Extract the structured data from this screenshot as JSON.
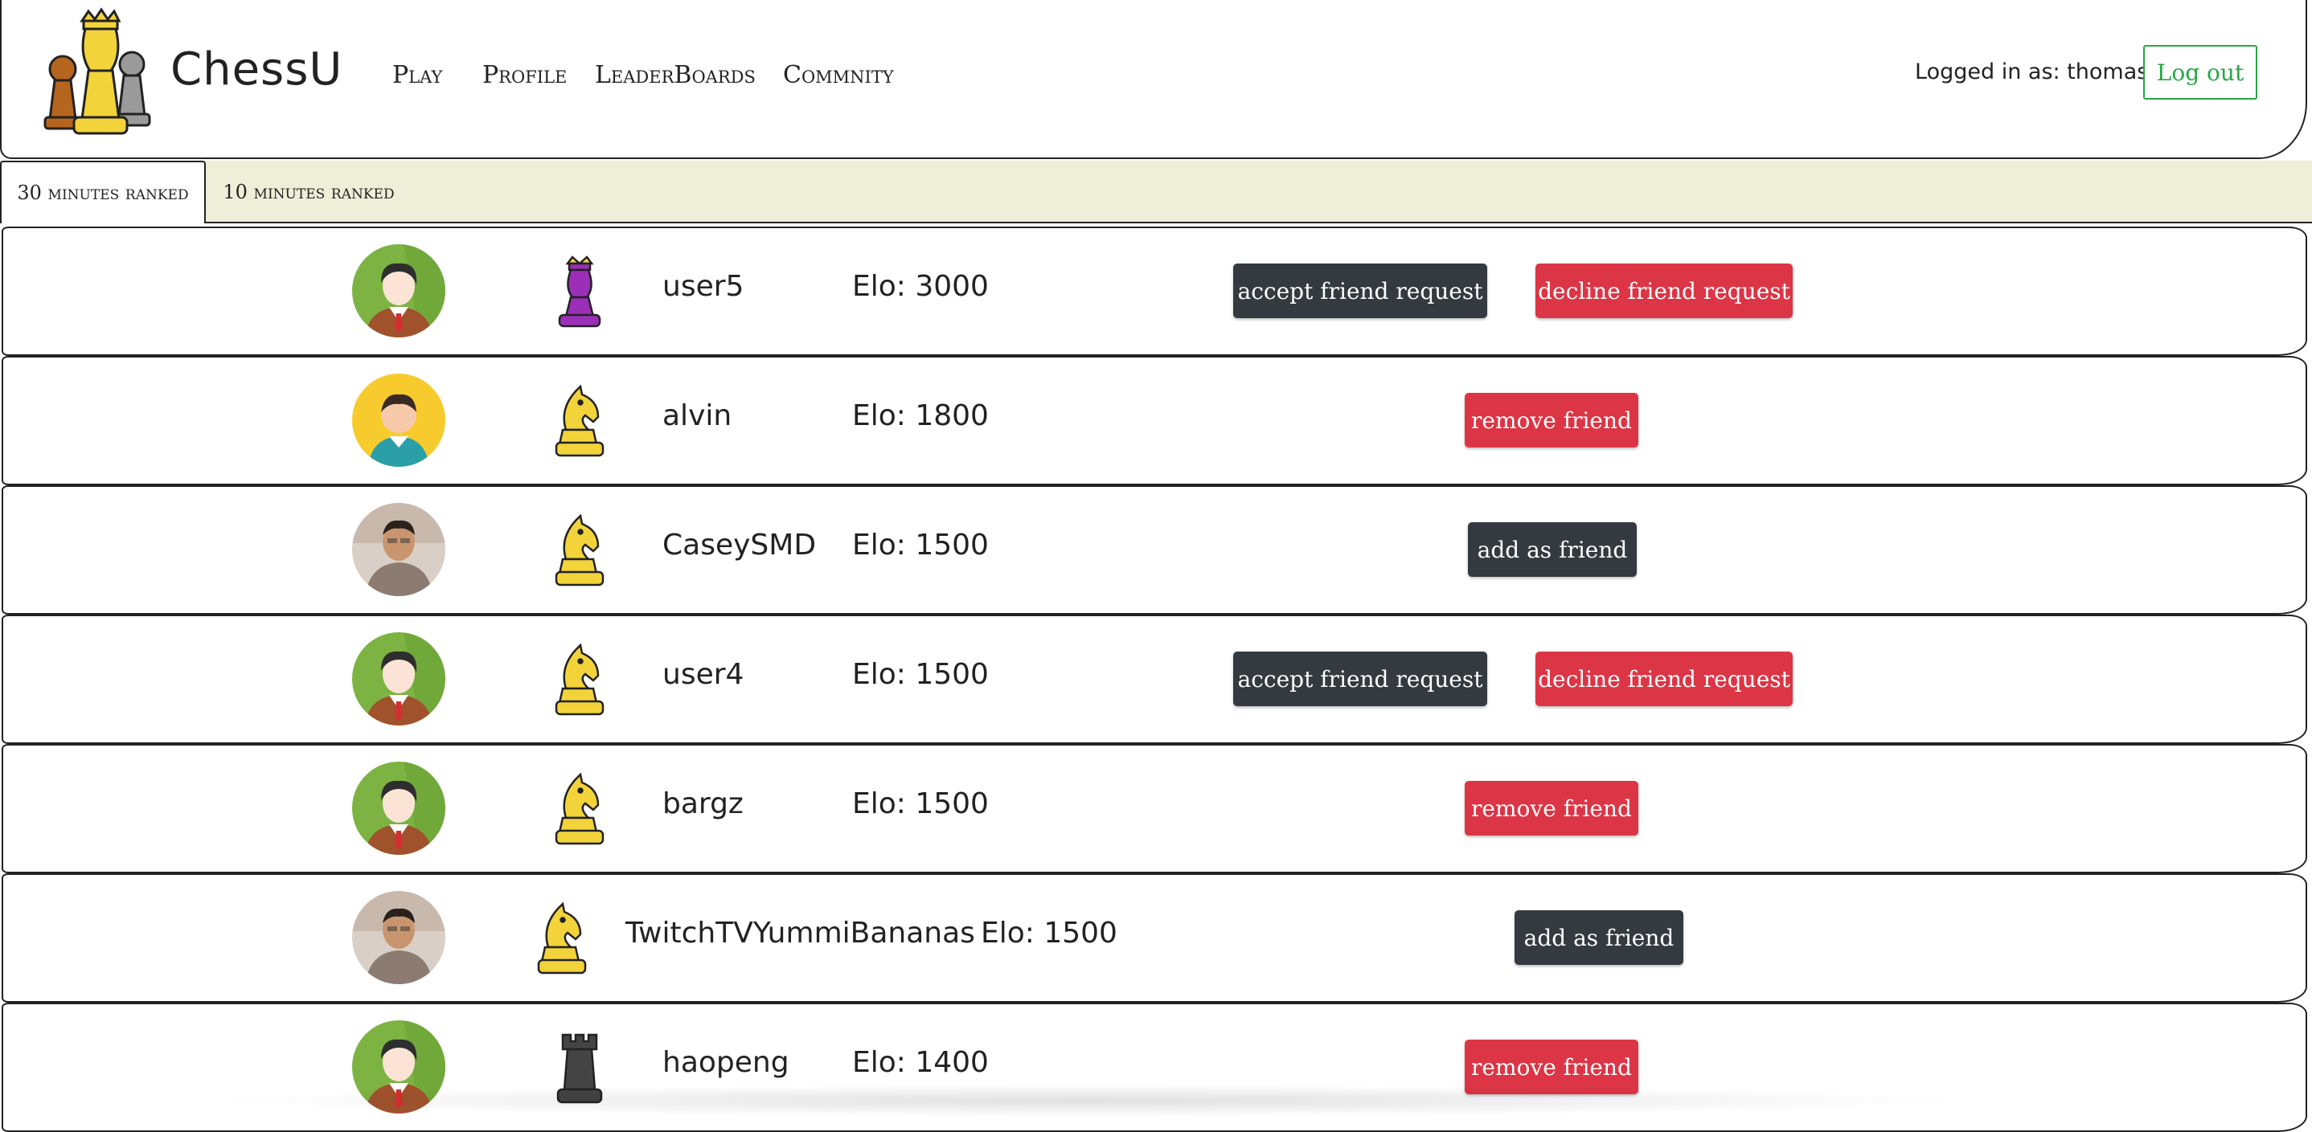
{
  "app": {
    "name": "ChessU",
    "logo_icon": "chess-pieces-logo-icon"
  },
  "nav": [
    {
      "label": "Play"
    },
    {
      "label": "Profile"
    },
    {
      "label": "LeaderBoards"
    },
    {
      "label": "Commnity"
    }
  ],
  "user": {
    "logged_in_text": "Logged in as: thomas",
    "logout_label": "Log out"
  },
  "tabs": [
    {
      "label": "30 minutes ranked",
      "active": true
    },
    {
      "label": "10 minutes ranked",
      "active": false
    }
  ],
  "colors": {
    "accent_green": "#28a745",
    "danger_red": "#dc3545",
    "dark_button": "#343a40",
    "tabbar_bg": "#efeed8"
  },
  "players": [
    {
      "username": "user5",
      "elo": "Elo: 3000",
      "rank_icon": "purple-king-icon",
      "avatar": "default-male-green-avatar",
      "actions": [
        "accept friend request",
        "decline friend request"
      ]
    },
    {
      "username": "alvin",
      "elo": "Elo: 1800",
      "rank_icon": "gold-knight-icon",
      "avatar": "default-male-yellow-avatar",
      "actions": [
        "remove friend"
      ]
    },
    {
      "username": "CaseySMD",
      "elo": "Elo: 1500",
      "rank_icon": "gold-knight-icon",
      "avatar": "photo-avatar",
      "actions": [
        "add as friend"
      ]
    },
    {
      "username": "user4",
      "elo": "Elo: 1500",
      "rank_icon": "gold-knight-icon",
      "avatar": "default-male-green-avatar",
      "actions": [
        "accept friend request",
        "decline friend request"
      ]
    },
    {
      "username": "bargz",
      "elo": "Elo: 1500",
      "rank_icon": "gold-knight-icon",
      "avatar": "default-male-green-avatar",
      "actions": [
        "remove friend"
      ]
    },
    {
      "username": "TwitchTVYummiBananas",
      "elo": "Elo: 1500",
      "rank_icon": "gold-knight-icon",
      "avatar": "photo-avatar",
      "actions": [
        "add as friend"
      ]
    },
    {
      "username": "haopeng",
      "elo": "Elo: 1400",
      "rank_icon": "black-rook-icon",
      "avatar": "default-male-green-avatar",
      "actions": [
        "remove friend"
      ]
    }
  ]
}
